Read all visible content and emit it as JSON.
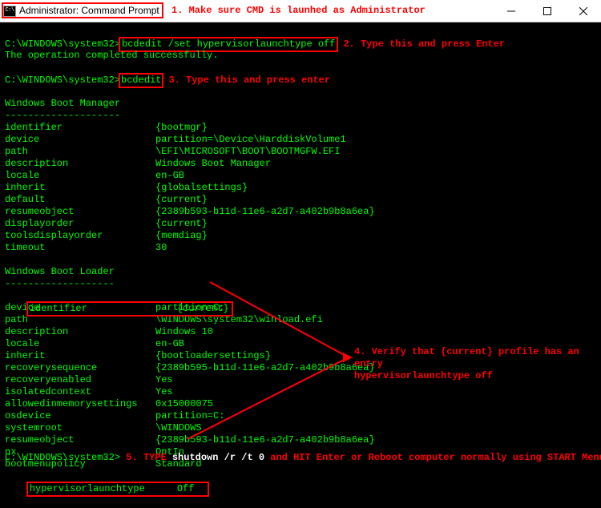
{
  "window": {
    "title": "Administrator: Command Prompt"
  },
  "annotations": {
    "a1": "1. Make sure CMD is launhed as Administrator",
    "a2": "2. Type this and press Enter",
    "a3": "3. Type this and press enter",
    "a4a": "4. Verify that {current} profile has an entry",
    "a4b": "hypervisorlaunchtype off",
    "a5_pre": "5. TYPE ",
    "a5_cmd": "shutdown /r /t 0",
    "a5_post": " and HIT Enter or Reboot computer normally using START Menu"
  },
  "prompt": "C:\\WINDOWS\\system32>",
  "cmd1": "bcdedit /set hypervisorlaunchtype off",
  "cmd1_result": "The operation completed successfully.",
  "cmd2": "bcdedit",
  "bootmgr_title": "Windows Boot Manager",
  "bootmgr_underline": "--------------------",
  "bootmgr": {
    "identifier": "{bootmgr}",
    "device": "partition=\\Device\\HarddiskVolume1",
    "path": "\\EFI\\MICROSOFT\\BOOT\\BOOTMGFW.EFI",
    "description": "Windows Boot Manager",
    "locale": "en-GB",
    "inherit": "{globalsettings}",
    "default": "{current}",
    "resumeobject": "{2389b593-b11d-11e6-a2d7-a402b9b8a6ea}",
    "displayorder": "{current}",
    "toolsdisplayorder": "{memdiag}",
    "timeout": "30"
  },
  "loader_title": "Windows Boot Loader",
  "loader_underline": "-------------------",
  "loader": {
    "identifier": "{current}",
    "device_k": "device",
    "device_v": "partition=C:",
    "path": "\\WINDOWS\\system32\\winload.efi",
    "description": "Windows 10",
    "locale": "en-GB",
    "inherit": "{bootloadersettings}",
    "recoverysequence": "{2389b595-b11d-11e6-a2d7-a402b9b8a6ea}",
    "recoveryenabled": "Yes",
    "isolatedcontext": "Yes",
    "allowedinmemorysettings": "0x15000075",
    "osdevice": "partition=C:",
    "systemroot": "\\WINDOWS",
    "resumeobject": "{2389b593-b11d-11e6-a2d7-a402b9b8a6ea}",
    "nx": "OptIn",
    "bootmenupolicy": "Standard",
    "hypervisorlaunchtype": "Off"
  },
  "labels": {
    "identifier": "identifier",
    "device": "device",
    "path": "path",
    "description": "description",
    "locale": "locale",
    "inherit": "inherit",
    "default": "default",
    "resumeobject": "resumeobject",
    "displayorder": "displayorder",
    "toolsdisplayorder": "toolsdisplayorder",
    "timeout": "timeout",
    "recoverysequence": "recoverysequence",
    "recoveryenabled": "recoveryenabled",
    "isolatedcontext": "isolatedcontext",
    "allowedinmemorysettings": "allowedinmemorysettings",
    "osdevice": "osdevice",
    "systemroot": "systemroot",
    "nx": "nx",
    "bootmenupolicy": "bootmenupolicy",
    "hypervisorlaunchtype": "hypervisorlaunchtype"
  }
}
